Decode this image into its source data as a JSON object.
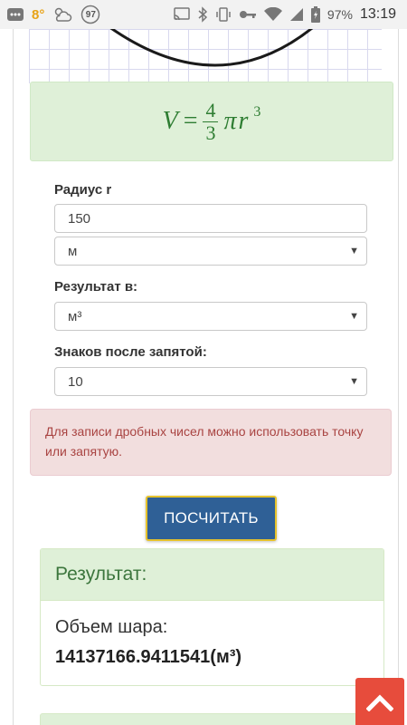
{
  "status_bar": {
    "temperature": "8°",
    "notification_count": "97",
    "battery_percent": "97%",
    "time": "13:19",
    "icons": [
      "ellipsis-icon",
      "weather-icon",
      "badge-icon",
      "cast-icon",
      "bluetooth-icon",
      "vibrate-icon",
      "key-icon",
      "wifi-icon",
      "signal-icon",
      "battery-icon"
    ]
  },
  "formula": {
    "lhs": "V",
    "equals": "=",
    "numerator": "4",
    "denominator": "3",
    "pi": "π",
    "variable": "r",
    "exponent": "3"
  },
  "form": {
    "radius_label": "Радиус r",
    "radius_value": "150",
    "radius_unit": "м",
    "result_in_label": "Результат в:",
    "result_unit": "м³",
    "decimals_label": "Знаков после запятой:",
    "decimals_value": "10"
  },
  "alert": {
    "text": "Для записи дробных чисел можно использовать точку или запятую."
  },
  "calculate_button": "ПОСЧИТАТЬ",
  "result": {
    "heading": "Результат:",
    "label": "Объем шара:",
    "value": "14137166.9411541(м³)"
  },
  "colors": {
    "success_bg": "#dff0d8",
    "success_text": "#3c763d",
    "danger_bg": "#f2dede",
    "danger_text": "#a94442",
    "button_bg": "#2f6096",
    "button_border": "#e6c22c",
    "scroll_top_bg": "#e74c3c"
  }
}
